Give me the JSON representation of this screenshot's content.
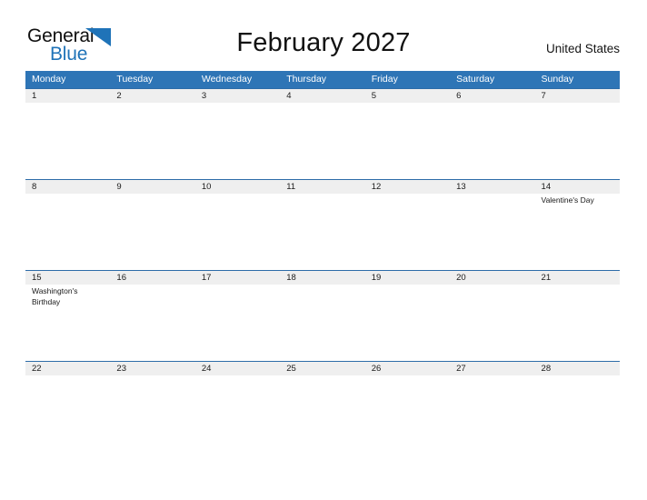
{
  "header": {
    "logo": {
      "text_primary": "General",
      "text_secondary": "Blue",
      "triangle_icon": "triangle-icon",
      "primary_color": "#101010",
      "secondary_color": "#1f73b8"
    },
    "title": "February 2027",
    "country": "United States"
  },
  "calendar": {
    "accent_color": "#2e75b6",
    "rule_color": "#2d6ca8",
    "number_band_color": "#efefef",
    "day_headers": [
      "Monday",
      "Tuesday",
      "Wednesday",
      "Thursday",
      "Friday",
      "Saturday",
      "Sunday"
    ],
    "weeks": [
      {
        "days": [
          {
            "number": "1",
            "event": ""
          },
          {
            "number": "2",
            "event": ""
          },
          {
            "number": "3",
            "event": ""
          },
          {
            "number": "4",
            "event": ""
          },
          {
            "number": "5",
            "event": ""
          },
          {
            "number": "6",
            "event": ""
          },
          {
            "number": "7",
            "event": ""
          }
        ]
      },
      {
        "days": [
          {
            "number": "8",
            "event": ""
          },
          {
            "number": "9",
            "event": ""
          },
          {
            "number": "10",
            "event": ""
          },
          {
            "number": "11",
            "event": ""
          },
          {
            "number": "12",
            "event": ""
          },
          {
            "number": "13",
            "event": ""
          },
          {
            "number": "14",
            "event": "Valentine's Day"
          }
        ]
      },
      {
        "days": [
          {
            "number": "15",
            "event": "Washington's Birthday"
          },
          {
            "number": "16",
            "event": ""
          },
          {
            "number": "17",
            "event": ""
          },
          {
            "number": "18",
            "event": ""
          },
          {
            "number": "19",
            "event": ""
          },
          {
            "number": "20",
            "event": ""
          },
          {
            "number": "21",
            "event": ""
          }
        ]
      },
      {
        "days": [
          {
            "number": "22",
            "event": ""
          },
          {
            "number": "23",
            "event": ""
          },
          {
            "number": "24",
            "event": ""
          },
          {
            "number": "25",
            "event": ""
          },
          {
            "number": "26",
            "event": ""
          },
          {
            "number": "27",
            "event": ""
          },
          {
            "number": "28",
            "event": ""
          }
        ]
      }
    ]
  }
}
